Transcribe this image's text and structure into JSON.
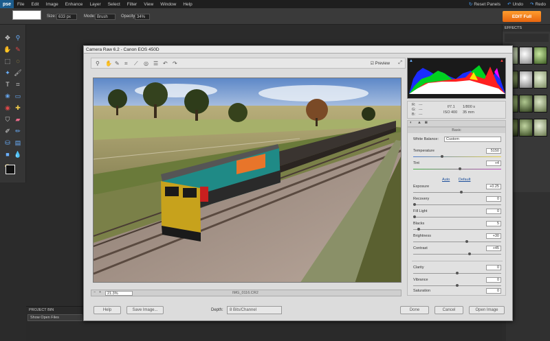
{
  "app": {
    "logo": "pse"
  },
  "menu": [
    "File",
    "Edit",
    "Image",
    "Enhance",
    "Layer",
    "Select",
    "Filter",
    "View",
    "Window",
    "Help"
  ],
  "topright": {
    "reset": "Reset Panels",
    "undo": "Undo",
    "redo": "Redo"
  },
  "options": {
    "size_label": "Size:",
    "size_value": "633 px",
    "mode_label": "Mode:",
    "mode_value": "Brush",
    "opacity_label": "Opacity:",
    "opacity_value": "34%"
  },
  "edit_full": "EDIT Full",
  "effects": {
    "title": "EFFECTS"
  },
  "project_bin": {
    "title": "PROJECT BIN",
    "select": "Show Open Files"
  },
  "dialog": {
    "title": "Camera Raw 6.2 - Canon EOS 450D",
    "preview": "Preview",
    "zoom": "21.3%",
    "filename": "IMG_0116.CR2",
    "readout": {
      "r": "R:",
      "g": "G:",
      "b": "B:",
      "dashes": "---",
      "aperture": "f/7.1",
      "shutter": "1/800 s",
      "iso": "ISO 400",
      "focal": "35 mm"
    },
    "panel_title": "Basic",
    "white_balance_label": "White Balance:",
    "white_balance_value": "Custom",
    "auto": "Auto",
    "default": "Default",
    "sliders": [
      {
        "label": "Temperature",
        "value": "5150"
      },
      {
        "label": "Tint",
        "value": "+4"
      },
      {
        "label": "Exposure",
        "value": "+0.25"
      },
      {
        "label": "Recovery",
        "value": "0"
      },
      {
        "label": "Fill Light",
        "value": "0"
      },
      {
        "label": "Blacks",
        "value": "5"
      },
      {
        "label": "Brightness",
        "value": "+30"
      },
      {
        "label": "Contrast",
        "value": "+45"
      },
      {
        "label": "Clarity",
        "value": "0"
      },
      {
        "label": "Vibrance",
        "value": "0"
      },
      {
        "label": "Saturation",
        "value": "0"
      }
    ],
    "buttons": {
      "help": "Help",
      "save": "Save Image...",
      "done": "Done",
      "cancel": "Cancel",
      "open": "Open Image"
    },
    "depth_label": "Depth:",
    "depth_value": "8 Bits/Channel"
  }
}
